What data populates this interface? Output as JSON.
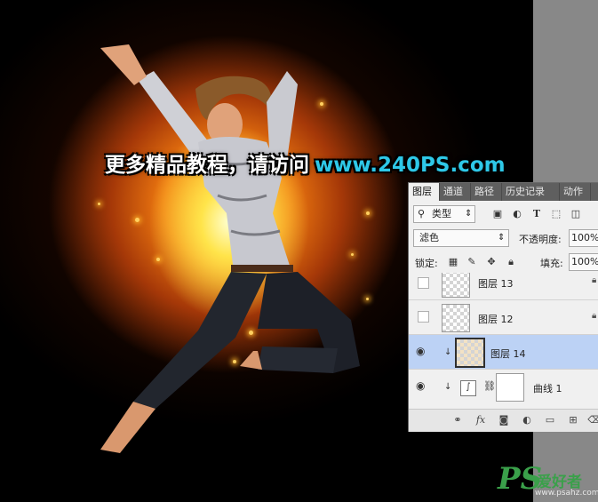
{
  "watermark": {
    "text_cn": "更多精品教程，请访问",
    "text_url": "www.240PS.com",
    "url_color": "#2ec8e8"
  },
  "site_logo": {
    "ps": "PS",
    "cn": "爱好者",
    "url": "www.psahz.com",
    "color": "#3aa04a"
  },
  "layers_panel": {
    "tabs": [
      {
        "label": "图层",
        "active": true
      },
      {
        "label": "通道",
        "active": false
      },
      {
        "label": "路径",
        "active": false
      },
      {
        "label": "历史记录",
        "active": false
      },
      {
        "label": "动作",
        "active": false
      }
    ],
    "filter": {
      "icon": "search-icon",
      "label": "类型",
      "arrow": "⇕"
    },
    "filter_icons": [
      "image-filter-icon",
      "adjustment-filter-icon",
      "type-filter-icon",
      "shape-filter-icon",
      "smart-object-filter-icon"
    ],
    "blend_mode": "滤色",
    "opacity_label": "不透明度:",
    "opacity_value": "100%",
    "lock_label": "锁定:",
    "lock_icons": [
      "lock-transparent-icon",
      "lock-brush-icon",
      "lock-move-icon",
      "lock-all-icon"
    ],
    "fill_label": "填充:",
    "fill_value": "100%",
    "layers": [
      {
        "name": "图层 13",
        "visible": false,
        "locked": true,
        "selected": false,
        "clipped": false
      },
      {
        "name": "图层 12",
        "visible": false,
        "locked": true,
        "selected": false,
        "clipped": false
      },
      {
        "name": "图层 14",
        "visible": true,
        "locked": false,
        "selected": true,
        "clipped": true
      },
      {
        "name": "曲线 1",
        "visible": true,
        "locked": false,
        "selected": false,
        "clipped": true,
        "adjustment": "curves"
      }
    ],
    "footer_icons": [
      "link-layers-icon",
      "fx-icon",
      "add-mask-icon",
      "adjustment-layer-icon",
      "new-group-icon",
      "new-layer-icon",
      "delete-layer-icon"
    ],
    "footer_fx": "fx"
  }
}
